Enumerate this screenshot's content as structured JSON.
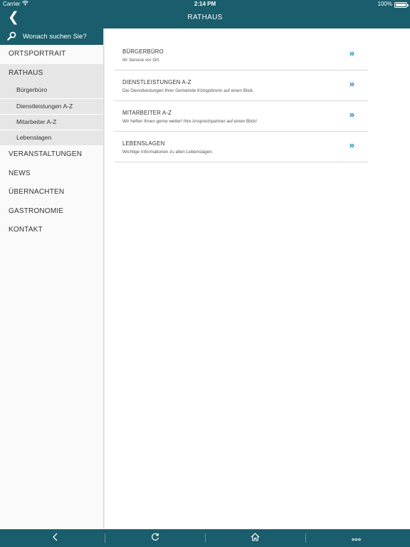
{
  "status_bar": {
    "carrier": "Carrier",
    "time": "2:14 PM",
    "battery": "100%"
  },
  "nav": {
    "back_icon": "chevron-left-icon",
    "title": "RATHAUS"
  },
  "sidebar": {
    "search_placeholder": "Wonach suchen Sie?",
    "items": [
      {
        "label": "ORTSPORTRAIT"
      },
      {
        "label": "RATHAUS",
        "active": true,
        "children": [
          {
            "label": "Bürgerbüro"
          },
          {
            "label": "Dienstleistungen A-Z"
          },
          {
            "label": "Mitarbeiter A-Z"
          },
          {
            "label": "Lebenslagen"
          }
        ]
      },
      {
        "label": "VERANSTALTUNGEN"
      },
      {
        "label": "NEWS"
      },
      {
        "label": "ÜBERNACHTEN"
      },
      {
        "label": "GASTRONOMIE"
      },
      {
        "label": "KONTAKT"
      }
    ]
  },
  "main": {
    "rows": [
      {
        "title": "BÜRGERBÜRO",
        "description": "Ihr Service vor Ort."
      },
      {
        "title": "DIENSTLEISTUNGEN A-Z",
        "description": "Die Dienstleistungen Ihrer Gemeinde Königsbronn auf einen Blick."
      },
      {
        "title": "MITARBEITER A-Z",
        "description": "Wir helfen Ihnen gerne weiter! Ihre Ansprechpartner auf einen Blick!"
      },
      {
        "title": "LEBENSLAGEN",
        "description": "Wichtige Informationen zu allen Lebenslagen."
      }
    ],
    "row_chevron": "»"
  },
  "bottom_bar": {
    "buttons": [
      "back-icon",
      "refresh-icon",
      "home-icon",
      "more-icon"
    ]
  },
  "colors": {
    "brand": "#1a5d6c",
    "accent": "#1a8aa8",
    "sidebar_active": "#e6e6e6"
  }
}
